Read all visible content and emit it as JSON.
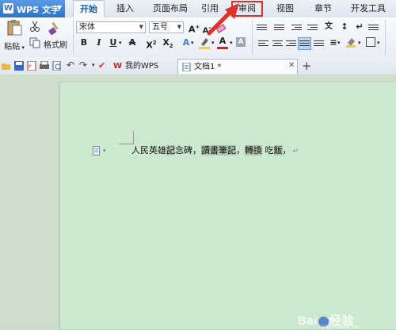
{
  "app_menu": {
    "label": "WPS 文字"
  },
  "tabs": [
    {
      "label": "开始",
      "active": true
    },
    {
      "label": "插入"
    },
    {
      "label": "页面布局"
    },
    {
      "label": "引用"
    },
    {
      "label": "审阅"
    },
    {
      "label": "视图"
    },
    {
      "label": "章节"
    },
    {
      "label": "开发工具"
    }
  ],
  "ribbon": {
    "paste_label": "粘贴",
    "format_painter_label": "格式刷",
    "font_name": "宋体",
    "font_size": "五号"
  },
  "doc_tabs": [
    {
      "label": "我的WPS"
    },
    {
      "label": "文档1 *"
    }
  ],
  "document": {
    "segments": [
      {
        "text": "人民英雄",
        "highlight": false
      },
      {
        "text": "記",
        "highlight": true
      },
      {
        "text": "念碑，",
        "highlight": false
      },
      {
        "text": "讀書筆記",
        "highlight": true
      },
      {
        "text": "，",
        "highlight": false
      },
      {
        "text": "轉換",
        "highlight": true
      },
      {
        "text": " 吃",
        "highlight": false
      },
      {
        "text": "飯",
        "highlight": true
      },
      {
        "text": "，",
        "highlight": false
      }
    ]
  },
  "colors": {
    "app_menu": "#2f74c8",
    "annotation_box": "#e0302b",
    "annotation_arrow": "#e0302b",
    "document_background": "#cce8cf",
    "font_color_bar": "#e02020",
    "highlight_bar": "#f5d020"
  },
  "watermark": {
    "brand": "Baidu",
    "suffix": "经验",
    "url": "jingyan.baidu.com"
  }
}
